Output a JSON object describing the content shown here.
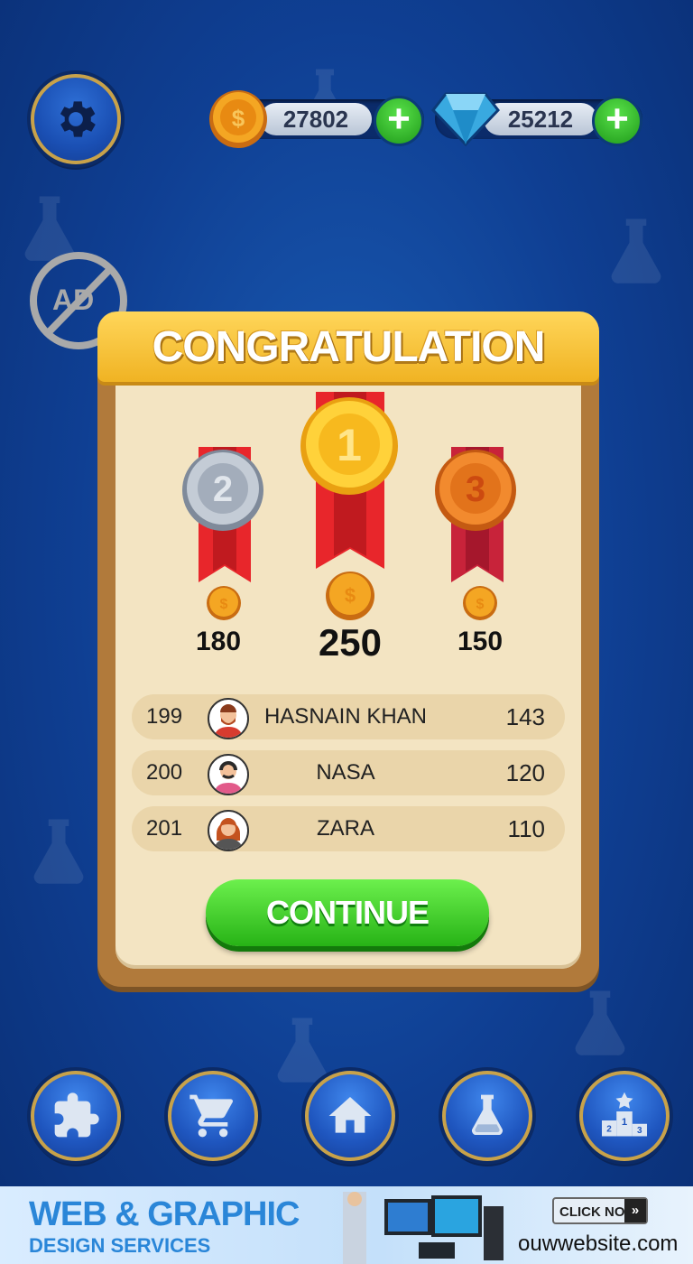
{
  "top_bar": {
    "coins": "27802",
    "gems": "25212",
    "plus_label": "+"
  },
  "ad_icon_label": "AD",
  "dialog": {
    "title": "CONGRATULATION",
    "podium": [
      {
        "rank": "2",
        "score": "180",
        "medal": "silver"
      },
      {
        "rank": "1",
        "score": "250",
        "medal": "gold"
      },
      {
        "rank": "3",
        "score": "150",
        "medal": "bronze"
      }
    ],
    "leaderboard": [
      {
        "rank": "199",
        "name": "HASNAIN KHAN",
        "score": "143"
      },
      {
        "rank": "200",
        "name": "NASA",
        "score": "120"
      },
      {
        "rank": "201",
        "name": "ZARA",
        "score": "110"
      }
    ],
    "continue_label": "CONTINUE"
  },
  "bottom_nav": [
    {
      "icon": "puzzle-icon"
    },
    {
      "icon": "cart-icon"
    },
    {
      "icon": "home-icon"
    },
    {
      "icon": "flask-icon"
    },
    {
      "icon": "podium-icon"
    }
  ],
  "ad_banner": {
    "headline": "WEB & GRAPHIC",
    "subline": "DESIGN SERVICES",
    "cta": "CLICK NOW",
    "url": "ouwwebsite.com"
  },
  "colors": {
    "background": "#1b5fb8",
    "banner": "#f0b323",
    "panel": "#f3e4c2",
    "continue": "#27b316"
  }
}
